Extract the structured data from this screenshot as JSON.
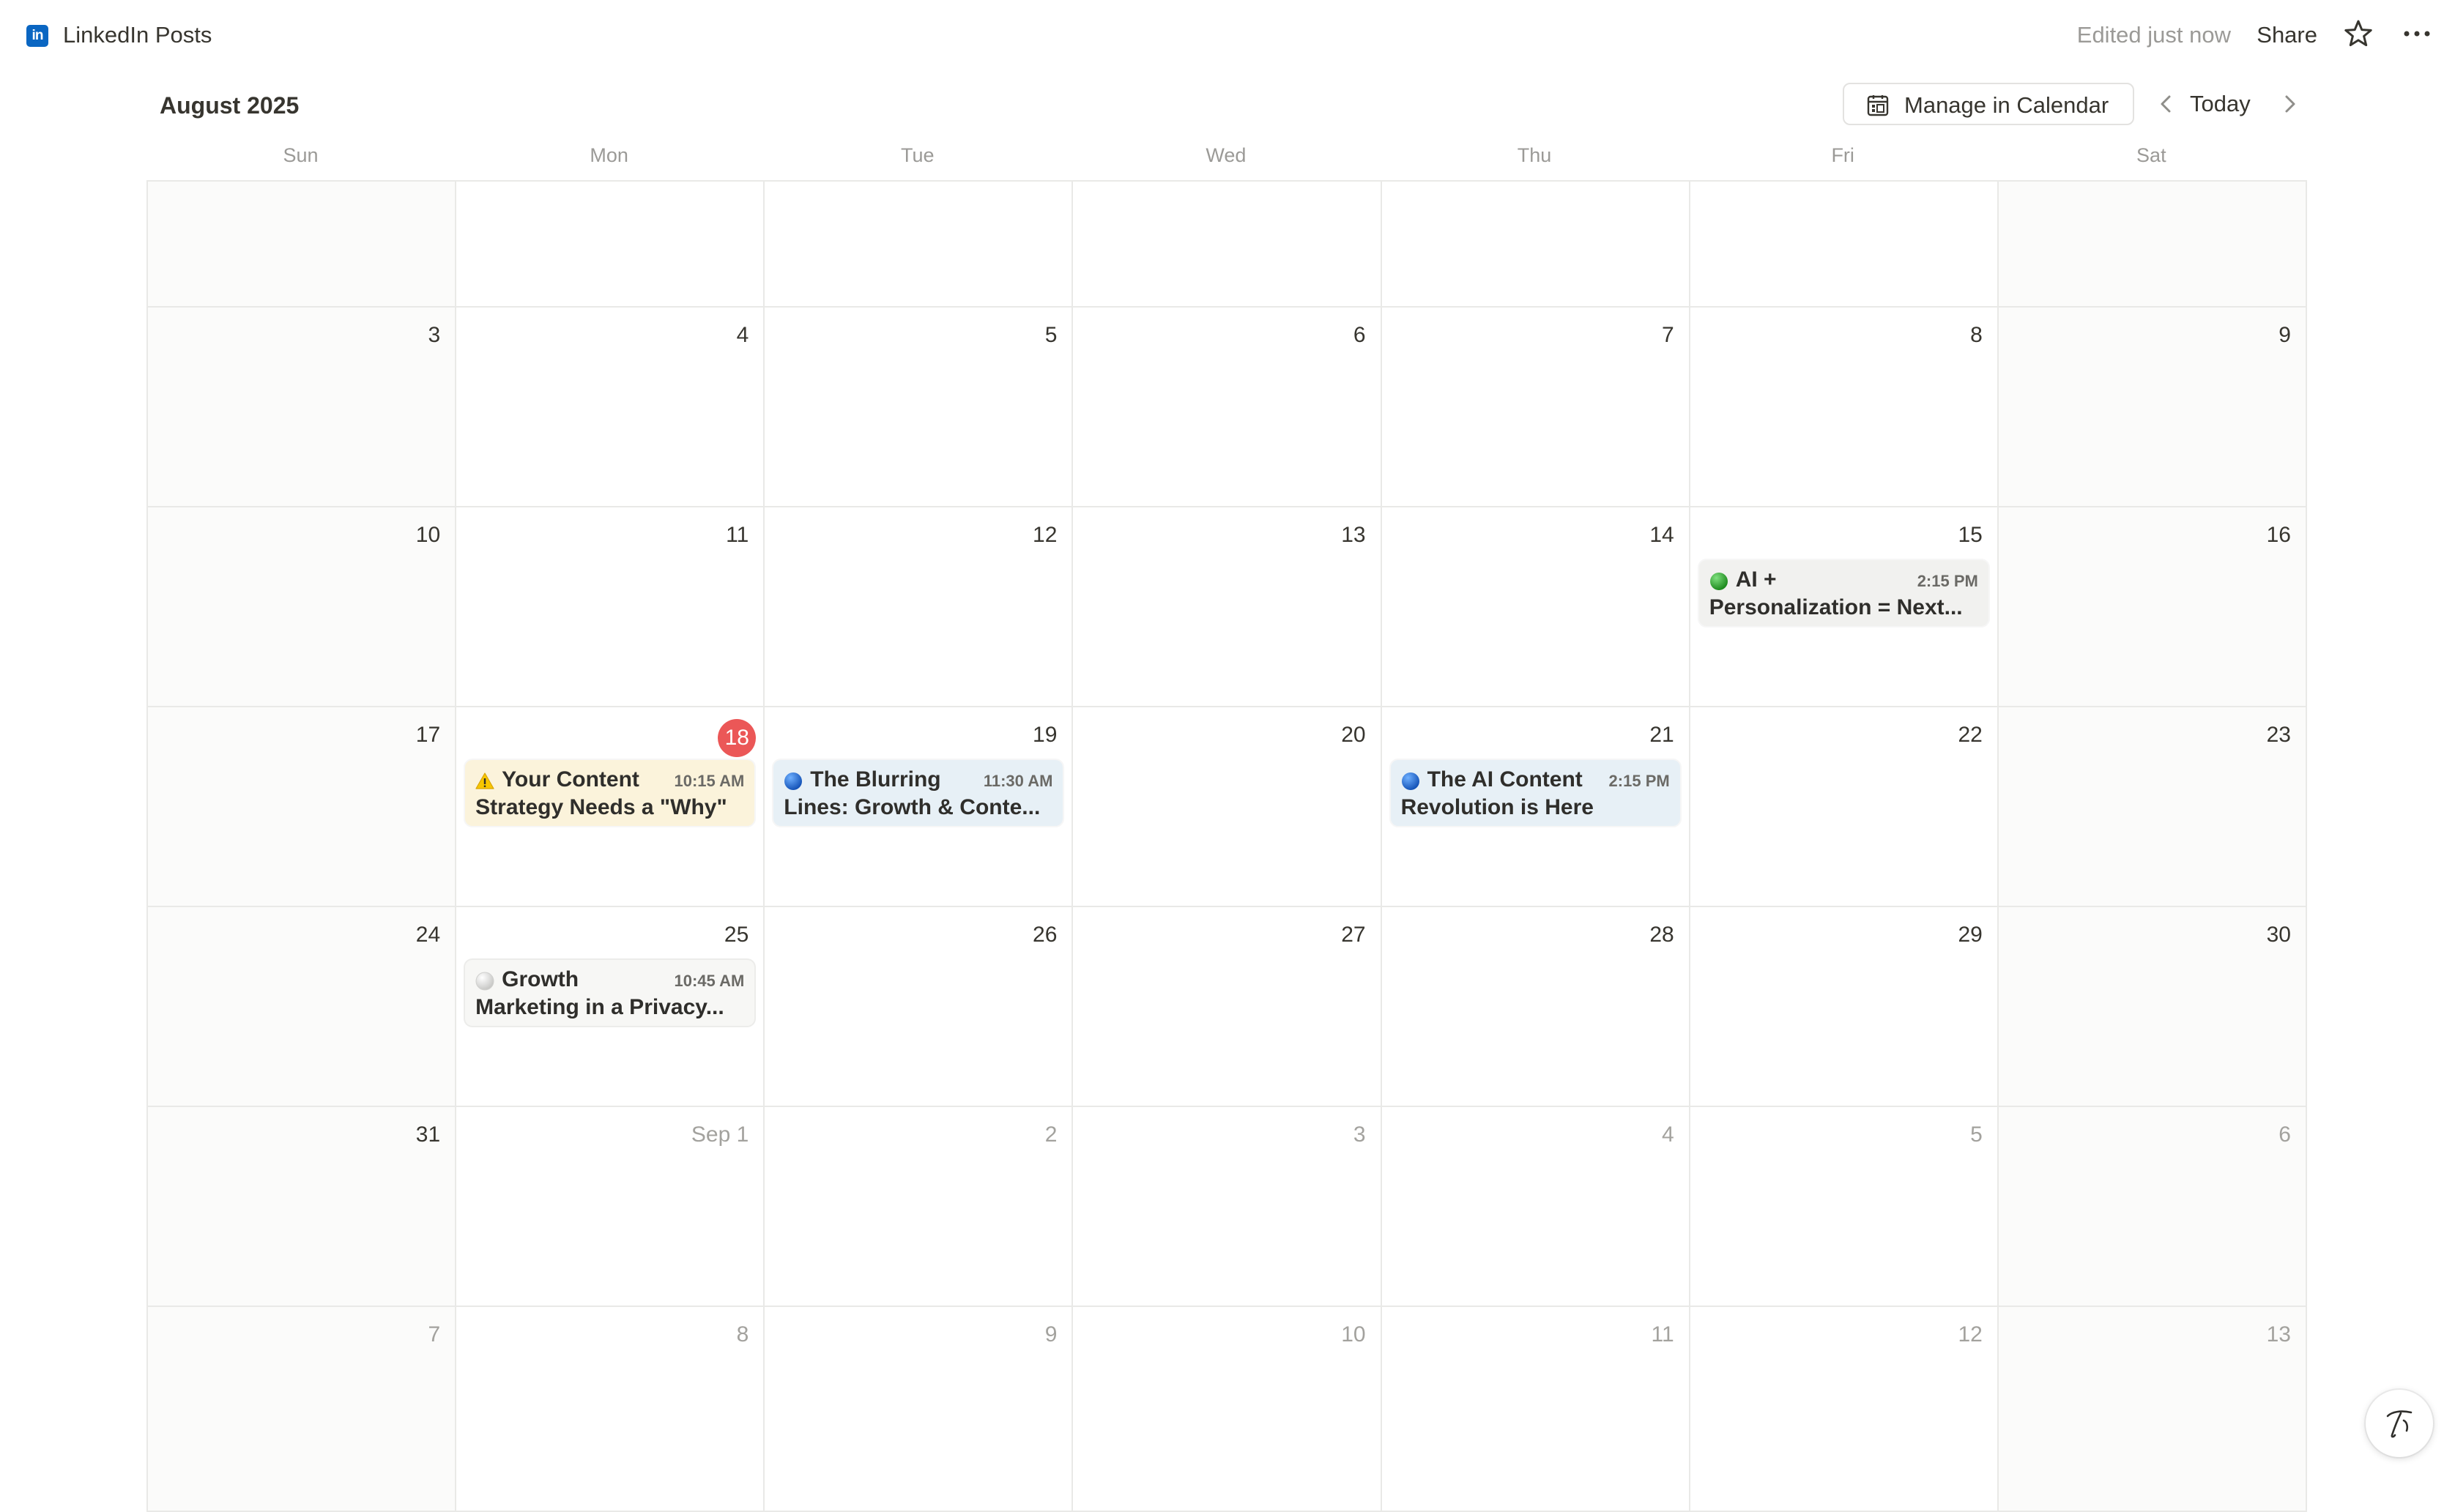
{
  "topbar": {
    "app_icon": "linkedin-icon",
    "app_icon_text": "in",
    "title": "LinkedIn Posts",
    "edited": "Edited just now",
    "share": "Share",
    "icons": [
      "star-icon",
      "more-horizontal-icon"
    ]
  },
  "calendar": {
    "month": "August 2025",
    "manage_button": "Manage in Calendar",
    "manage_icon": "calendar-icon",
    "today_button": "Today",
    "nav_icons": [
      "chevron-left-icon",
      "chevron-right-icon"
    ],
    "weekdays": [
      "Sun",
      "Mon",
      "Tue",
      "Wed",
      "Thu",
      "Fri",
      "Sat"
    ],
    "today_color": "#eb5757",
    "weeks": [
      [
        "",
        "",
        "",
        "",
        "",
        "",
        ""
      ],
      [
        "3",
        "4",
        "5",
        "6",
        "7",
        "8",
        "9"
      ],
      [
        "10",
        "11",
        "12",
        "13",
        "14",
        "15",
        "16"
      ],
      [
        "17",
        "18",
        "19",
        "20",
        "21",
        "22",
        "23"
      ],
      [
        "24",
        "25",
        "26",
        "27",
        "28",
        "29",
        "30"
      ],
      [
        "31",
        "Sep 1",
        "2",
        "3",
        "4",
        "5",
        "6"
      ],
      [
        "7",
        "8",
        "9",
        "10",
        "11",
        "12",
        "13"
      ]
    ],
    "events": {
      "fri15": {
        "icon": "green-circle-icon",
        "line1": "AI +",
        "line2": "Personalization = Next...",
        "time": "2:15 PM",
        "bg": "#f1f1ef",
        "dot": "#2e9e2e"
      },
      "mon18": {
        "icon": "warning-icon",
        "line1": "Your Content",
        "line2": "Strategy Needs a \"Why\"",
        "time": "10:15 AM",
        "bg": "#fbf3db",
        "dot": "#f2c200"
      },
      "tue19": {
        "icon": "blue-circle-icon",
        "line1": "The Blurring",
        "line2": "Lines: Growth & Conte...",
        "time": "11:30 AM",
        "bg": "#e7f0f6",
        "dot": "#1f6fd1"
      },
      "thu21": {
        "icon": "blue-circle-icon",
        "line1": "The AI Content",
        "line2": "Revolution is Here",
        "time": "2:15 PM",
        "bg": "#e7f0f6",
        "dot": "#1f6fd1"
      },
      "mon25": {
        "icon": "white-circle-icon",
        "line1": "Growth",
        "line2": "Marketing in a Privacy...",
        "time": "10:45 AM",
        "bg": "#f1f1ef",
        "dot": "#d9d9d7"
      }
    }
  },
  "help_icon": "help-signature-icon"
}
